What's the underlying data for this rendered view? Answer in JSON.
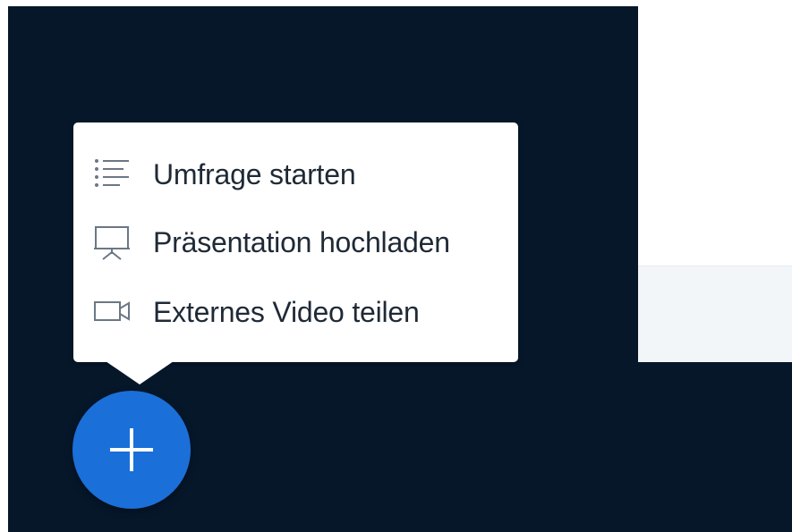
{
  "actions_menu": {
    "items": [
      {
        "label": "Umfrage starten",
        "icon": "list-icon"
      },
      {
        "label": "Präsentation hochladen",
        "icon": "presentation-icon"
      },
      {
        "label": "Externes Video teilen",
        "icon": "video-camera-icon"
      }
    ]
  },
  "fab": {
    "icon": "plus-icon"
  },
  "colors": {
    "background_dark": "#06172a",
    "menu_background": "#ffffff",
    "fab_blue": "#1b6fd8",
    "text": "#1f2a36",
    "light_strip": "#f3f6f9"
  }
}
